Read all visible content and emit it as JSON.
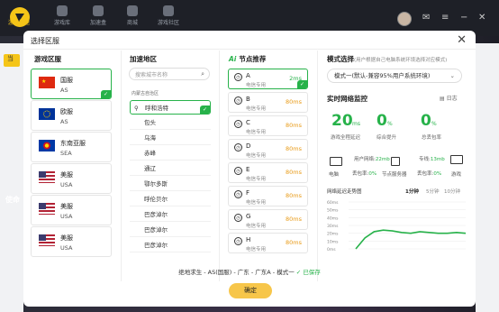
{
  "app": {
    "tabs": [
      {
        "label": "游戏加速"
      },
      {
        "label": "游戏库"
      },
      {
        "label": "加速盒"
      },
      {
        "label": "商城"
      },
      {
        "label": "游戏社区"
      }
    ],
    "side_label": "使命",
    "top_badge": "当"
  },
  "dialog": {
    "title": "选择区服",
    "columns": {
      "server": "游戏区服",
      "region": "加速地区",
      "node": "节点推荐",
      "node_brand": "Ai",
      "mode": "模式选择",
      "mode_note": "(用户根据自己电脑系统环境选择对应模式)"
    },
    "servers": [
      {
        "name": "国服",
        "code": "AS",
        "flag": "cn",
        "selected": true
      },
      {
        "name": "欧服",
        "code": "AS",
        "flag": "eu",
        "selected": false
      },
      {
        "name": "东南亚服",
        "code": "SEA",
        "flag": "asean",
        "selected": false
      },
      {
        "name": "美服",
        "code": "USA",
        "flag": "us",
        "selected": false
      },
      {
        "name": "美服",
        "code": "USA",
        "flag": "us",
        "selected": false
      },
      {
        "name": "美服",
        "code": "USA",
        "flag": "us",
        "selected": false
      }
    ],
    "region_search_placeholder": "搜索城市名称",
    "region_caption": "内蒙古自治区",
    "regions": [
      "呼和浩特",
      "包头",
      "乌海",
      "赤峰",
      "通辽",
      "鄂尔多斯",
      "呼伦贝尔",
      "巴彦淖尔",
      "巴彦淖尔",
      "巴彦淖尔"
    ],
    "nodes": [
      {
        "letter": "A",
        "sub": "电信专用",
        "ms": "2ms",
        "selected": true
      },
      {
        "letter": "B",
        "sub": "电信专用",
        "ms": "80ms",
        "selected": false
      },
      {
        "letter": "C",
        "sub": "电信专用",
        "ms": "80ms",
        "selected": false
      },
      {
        "letter": "D",
        "sub": "电信专用",
        "ms": "80ms",
        "selected": false
      },
      {
        "letter": "E",
        "sub": "电信专用",
        "ms": "80ms",
        "selected": false
      },
      {
        "letter": "F",
        "sub": "电信专用",
        "ms": "80ms",
        "selected": false
      },
      {
        "letter": "G",
        "sub": "电信专用",
        "ms": "80ms",
        "selected": false
      },
      {
        "letter": "H",
        "sub": "电信专用",
        "ms": "80ms",
        "selected": false
      }
    ],
    "mode_value": "模式一(默认-兼容95%用户系统环境)",
    "monitor": {
      "title": "实时网络监控",
      "log_label": "日志",
      "stats": [
        {
          "value": "20",
          "unit": "ms",
          "label": "游戏全程延迟"
        },
        {
          "value": "0",
          "unit": "%",
          "label": "综合提升"
        },
        {
          "value": "0",
          "unit": "%",
          "label": "总丢包率"
        }
      ],
      "user_network": "用户网络:",
      "user_network_val": "22mb",
      "dedicated": "专线:",
      "dedicated_val": "13mb",
      "loss1": "丢包率:",
      "loss1_val": "0%",
      "loss2": "丢包率:",
      "loss2_val": "0%",
      "pc_label": "电脑",
      "node_server_label": "节点服务器",
      "game_label": "游戏",
      "chart_title": "网络延迟走势图",
      "ranges": [
        "1分钟",
        "5分钟",
        "10分钟"
      ],
      "y_ticks": [
        "60ms",
        "50ms",
        "40ms",
        "30ms",
        "20ms",
        "10ms",
        "0ms"
      ]
    },
    "summary_prefix": "绝地求生 - AS(国服) - 广东 - 广东A - 模式一",
    "summary_saved": "已保存",
    "ok_label": "确定"
  },
  "chart_data": {
    "type": "line",
    "title": "网络延迟走势图",
    "ylim": [
      0,
      60
    ],
    "series": [
      {
        "values": [
          0,
          14,
          22,
          24,
          23,
          21,
          20,
          22,
          21,
          20,
          20,
          21,
          20
        ]
      }
    ]
  }
}
